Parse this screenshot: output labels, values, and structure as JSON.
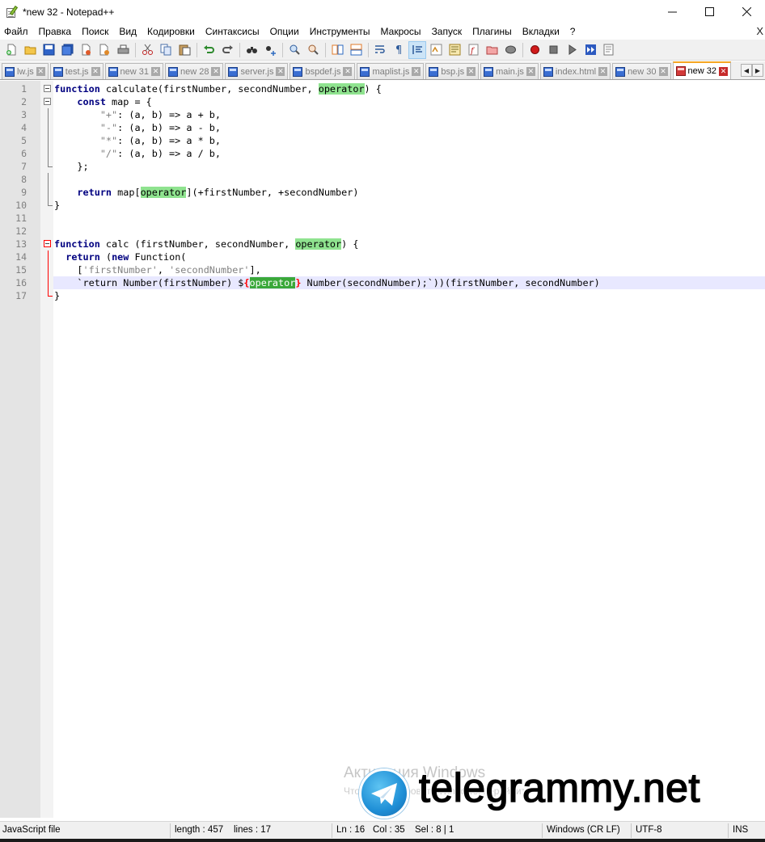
{
  "window": {
    "title": "*new 32 - Notepad++",
    "minimize_label": "—",
    "maximize_label": "☐",
    "close_label": "✕"
  },
  "menu": {
    "items": [
      "Файл",
      "Правка",
      "Поиск",
      "Вид",
      "Кодировки",
      "Синтаксисы",
      "Опции",
      "Инструменты",
      "Макросы",
      "Запуск",
      "Плагины",
      "Вкладки",
      "?"
    ],
    "close_doc_label": "X"
  },
  "toolbar": {
    "buttons": [
      "new-file",
      "open-file",
      "save",
      "save-all",
      "close",
      "close-all",
      "print",
      "cut",
      "copy",
      "paste",
      "undo",
      "redo",
      "find",
      "replace",
      "zoom-in",
      "zoom-out",
      "sync-vertical",
      "sync-horizontal",
      "word-wrap",
      "show-all-chars",
      "indent-guide",
      "user-defined-lang",
      "document-map",
      "function-list",
      "folder-workspace",
      "monitoring",
      "record-macro",
      "stop-record",
      "play-macro",
      "run-macro-multiple",
      "save-macro"
    ]
  },
  "tabs": [
    {
      "label": "lw.js",
      "unsaved": false,
      "active": false
    },
    {
      "label": "test.js",
      "unsaved": false,
      "active": false
    },
    {
      "label": "new 31",
      "unsaved": false,
      "active": false
    },
    {
      "label": "new 28",
      "unsaved": false,
      "active": false
    },
    {
      "label": "server.js",
      "unsaved": false,
      "active": false
    },
    {
      "label": "bspdef.js",
      "unsaved": false,
      "active": false
    },
    {
      "label": "maplist.js",
      "unsaved": false,
      "active": false
    },
    {
      "label": "bsp.js",
      "unsaved": false,
      "active": false
    },
    {
      "label": "main.js",
      "unsaved": false,
      "active": false
    },
    {
      "label": "index.html",
      "unsaved": false,
      "active": false
    },
    {
      "label": "new 30",
      "unsaved": false,
      "active": false
    },
    {
      "label": "new 32",
      "unsaved": true,
      "active": true
    }
  ],
  "tab_scroll": {
    "left": "◀",
    "right": "▶"
  },
  "editor": {
    "current_line": 16,
    "lines": [
      {
        "n": "1",
        "text": "function calculate(firstNumber, secondNumber, operator) {"
      },
      {
        "n": "2",
        "text": "    const map = {"
      },
      {
        "n": "3",
        "text": "        \"+\": (a, b) => a + b,"
      },
      {
        "n": "4",
        "text": "        \"-\": (a, b) => a - b,"
      },
      {
        "n": "5",
        "text": "        \"*\": (a, b) => a * b,"
      },
      {
        "n": "6",
        "text": "        \"/\": (a, b) => a / b,"
      },
      {
        "n": "7",
        "text": "    };"
      },
      {
        "n": "8",
        "text": ""
      },
      {
        "n": "9",
        "text": "    return map[operator](+firstNumber, +secondNumber)"
      },
      {
        "n": "10",
        "text": "}"
      },
      {
        "n": "11",
        "text": ""
      },
      {
        "n": "12",
        "text": ""
      },
      {
        "n": "13",
        "text": "function calc (firstNumber, secondNumber, operator) {"
      },
      {
        "n": "14",
        "text": "  return (new Function("
      },
      {
        "n": "15",
        "text": "    ['firstNumber', 'secondNumber'],"
      },
      {
        "n": "16",
        "text": "    `return Number(firstNumber) ${operator} Number(secondNumber);`))(firstNumber, secondNumber)"
      },
      {
        "n": "17",
        "text": "}"
      }
    ]
  },
  "watermark": {
    "activation_title": "Активация Windows",
    "activation_sub": "Чтобы активировать Windows, перейдите",
    "site": "telegrammy.net"
  },
  "status": {
    "language": "JavaScript file",
    "length": "length : 457",
    "lines": "lines : 17",
    "ln": "Ln : 16",
    "col": "Col : 35",
    "sel": "Sel : 8 | 1",
    "eol": "Windows (CR LF)",
    "encoding": "UTF-8",
    "mode": "INS"
  },
  "colors": {
    "keyword": "#000080",
    "string": "#808080",
    "smart_highlight": "#8fe38f",
    "current_line": "#e8e8ff",
    "fold_active": "#ff0000",
    "active_tab_accent": "#f5a623"
  }
}
